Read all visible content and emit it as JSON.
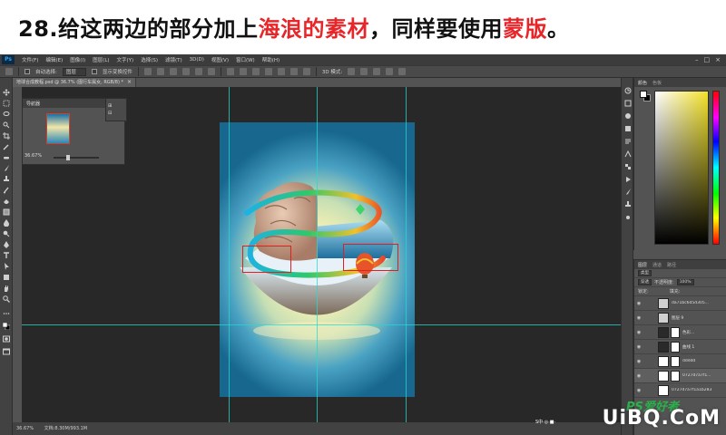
{
  "heading": {
    "prefix": "28.给这两边的部分加上",
    "highlight1": "海浪的素材",
    "middle": "，同样要使用",
    "highlight2": "蒙版",
    "suffix": "。"
  },
  "colors": {
    "highlight": "#e8262a",
    "guide": "#27d8d0",
    "selection": "#e02020"
  },
  "app": {
    "logo": "Ps",
    "menu": [
      "文件(F)",
      "编辑(E)",
      "图像(I)",
      "图层(L)",
      "文字(Y)",
      "选择(S)",
      "滤镜(T)",
      "3D(D)",
      "视图(V)",
      "窗口(W)",
      "帮助(H)"
    ]
  },
  "options": {
    "auto_select_label": "自动选择:",
    "auto_select_value": "图层",
    "show_transform_label": "显示变换控件",
    "mode_3d_label": "3D 模式:"
  },
  "document": {
    "tab_title": "地球合成教程.psd @ 36.7% (图行车属女, RGB/8) *",
    "close_glyph": "×"
  },
  "navigator": {
    "tab": "导航器",
    "zoom": "36.67%",
    "menu_items": [
      "⊞",
      "⊟"
    ]
  },
  "status": {
    "zoom": "36.67%",
    "doc": "文档:8.30M/993.1M"
  },
  "color_panel": {
    "tabs": [
      "颜色",
      "色板"
    ]
  },
  "layers_panel": {
    "tabs": [
      "图层",
      "通道",
      "路径"
    ],
    "filter_label": "类型",
    "blend_mode": "穿透",
    "opacity_label": "不透明度:",
    "opacity_value": "100%",
    "lock_label": "锁定:",
    "fill_label": "填充:",
    "layers": [
      "da71bc6d5d305...",
      "图层 9",
      "色彩...",
      "曲线 1",
      "ddddd",
      "0727d7a7f1...",
      "0727d7a7f1a1b283..."
    ]
  },
  "watermark": {
    "brand": "UiBQ.CoM",
    "ps_mark": "PS爱好者",
    "small": "S中·◎·■·"
  }
}
